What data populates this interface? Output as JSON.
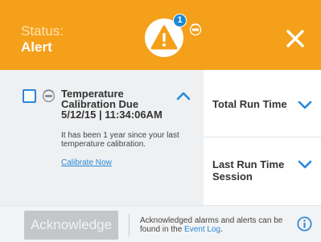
{
  "header": {
    "status_label": "Status:",
    "status_value": "Alert",
    "alert_count": "1",
    "colors": {
      "background": "#f5a01a",
      "badge": "#1a88d4"
    },
    "icons": {
      "alert": "warning-icon",
      "calibration": "calibration-icon",
      "close": "close-icon"
    }
  },
  "alert": {
    "title_line1": "Temperature",
    "title_line2": "Calibration Due",
    "title_line3": "5/12/15 | 11:34:06AM",
    "body": "It has been 1 year since your last temperature calibration.",
    "link": "Calibrate Now"
  },
  "right_panel": {
    "rows": [
      {
        "label": "Total Run Time"
      },
      {
        "label": "Last Run Time Session"
      }
    ]
  },
  "footer": {
    "acknowledge_label": "Acknowledge",
    "info_text": "Acknowledged alarms and alerts can be found in the ",
    "info_link": "Event Log",
    "info_suffix": ".",
    "accent": "#2a88d8"
  }
}
